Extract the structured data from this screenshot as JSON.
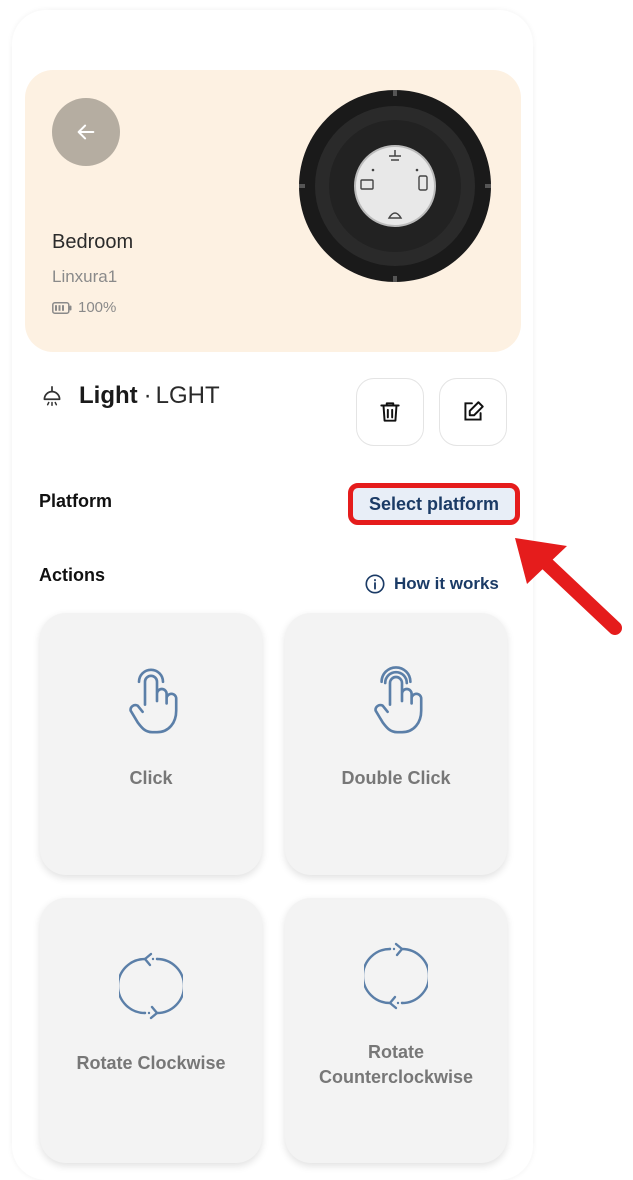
{
  "hero": {
    "device_name": "Bedroom",
    "device_model": "Linxura1",
    "battery": "100%"
  },
  "entity": {
    "name": "Light",
    "separator": "·",
    "code": "LGHT"
  },
  "platform": {
    "label": "Platform",
    "select_label": "Select platform"
  },
  "actions": {
    "label": "Actions",
    "how_it_works": "How it works",
    "cards": [
      {
        "label": "Click",
        "icon": "tap-gesture-icon"
      },
      {
        "label": "Double Click",
        "icon": "double-tap-gesture-icon"
      },
      {
        "label": "Rotate Clockwise",
        "icon": "rotate-clockwise-icon"
      },
      {
        "label": "Rotate Counterclockwise",
        "icon": "rotate-counterclockwise-icon"
      }
    ]
  },
  "colors": {
    "hero_bg": "#fdf1e2",
    "accent_text": "#1b3b66",
    "highlight": "#e51c1c",
    "icon_blue": "#5b7fa8"
  }
}
